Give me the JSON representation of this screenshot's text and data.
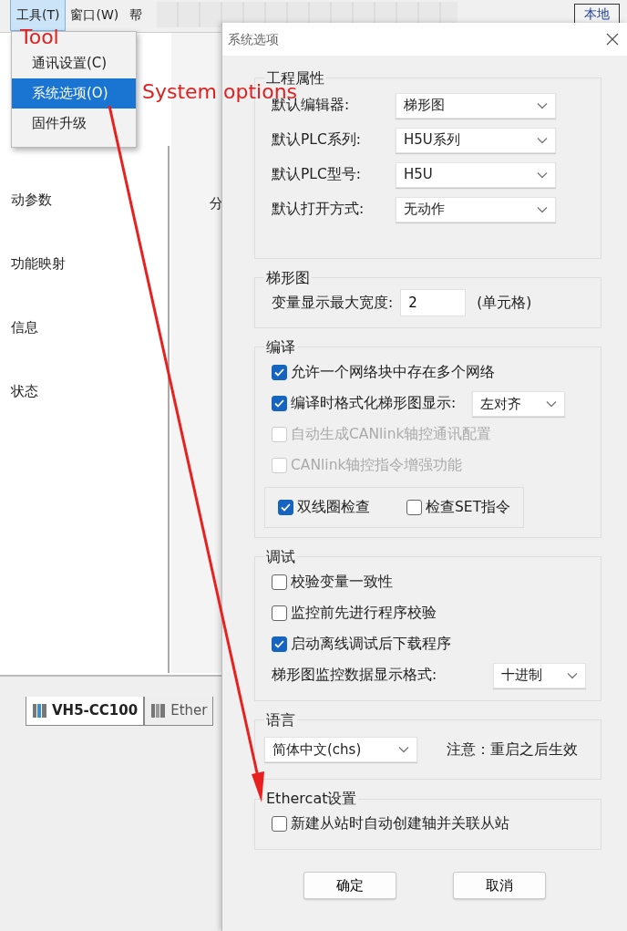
{
  "app": {
    "menu_bar": [
      {
        "label": "工具(T)",
        "selected": true
      },
      {
        "label": "窗口(W)",
        "selected": false
      },
      {
        "label": "帮",
        "selected": false
      }
    ],
    "toolbar_buttons": [
      {
        "label": "本地"
      }
    ],
    "menu": [
      {
        "label": "通讯设置(C)",
        "selected": false
      },
      {
        "label": "系统选项(O)",
        "selected": true
      },
      {
        "label": "固件升级",
        "selected": false
      }
    ],
    "side_items": [
      "动参数",
      "功能映射",
      "信息",
      "状态"
    ],
    "panel_label": "分",
    "bottom_tabs": [
      {
        "label": "VH5-CC100",
        "selected": true
      },
      {
        "label": "Ether",
        "selected": false
      }
    ]
  },
  "dialog": {
    "title": "系统选项",
    "groups": [
      {
        "title": "工程属性",
        "rows": [
          {
            "kind": "select",
            "label": "默认编辑器:",
            "value": "梯形图"
          },
          {
            "kind": "select",
            "label": "默认PLC系列:",
            "value": "H5U系列"
          },
          {
            "kind": "select",
            "label": "默认PLC型号:",
            "value": "H5U"
          },
          {
            "kind": "select",
            "label": "默认打开方式:",
            "value": "无动作"
          }
        ]
      },
      {
        "title": "梯形图",
        "rows": [
          {
            "kind": "input",
            "label": "变量显示最大宽度:",
            "value": "2",
            "unit": "(单元格)"
          }
        ]
      },
      {
        "title": "编译",
        "rows": [
          {
            "kind": "checkbox",
            "label": "允许一个网络块中存在多个网络",
            "checked": true,
            "disabled": false
          },
          {
            "kind": "checkbox",
            "label": "编译时格式化梯形图显示:",
            "checked": true,
            "disabled": false,
            "select": "左对齐"
          },
          {
            "kind": "checkbox",
            "label": "自动生成CANlink轴控通讯配置",
            "checked": false,
            "disabled": true
          },
          {
            "kind": "checkbox",
            "label": "CANlink轴控指令增强功能",
            "checked": false,
            "disabled": true
          },
          {
            "kind": "pair",
            "items": [
              {
                "label": "双线圈检查",
                "checked": true
              },
              {
                "label": "检查SET指令",
                "checked": false
              }
            ]
          }
        ]
      },
      {
        "title": "调试",
        "rows": [
          {
            "kind": "checkbox",
            "label": "校验变量一致性",
            "checked": false,
            "disabled": false
          },
          {
            "kind": "checkbox",
            "label": "监控前先进行程序校验",
            "checked": false,
            "disabled": false
          },
          {
            "kind": "checkbox",
            "label": "启动离线调试后下载程序",
            "checked": true,
            "disabled": false
          },
          {
            "kind": "label_select",
            "label": "梯形图监控数据显示格式:",
            "value": "十进制"
          }
        ]
      },
      {
        "title": "语言",
        "rows": [
          {
            "kind": "select_note",
            "value": "简体中文(chs)",
            "note": "注意：重启之后生效"
          }
        ]
      },
      {
        "title": "Ethercat设置",
        "rows": [
          {
            "kind": "checkbox",
            "label": "新建从站时自动创建轴并关联从站",
            "checked": false,
            "disabled": false
          }
        ]
      }
    ],
    "buttons": [
      "确定",
      "取消"
    ]
  },
  "annotations": [
    "Tool",
    "System options"
  ]
}
